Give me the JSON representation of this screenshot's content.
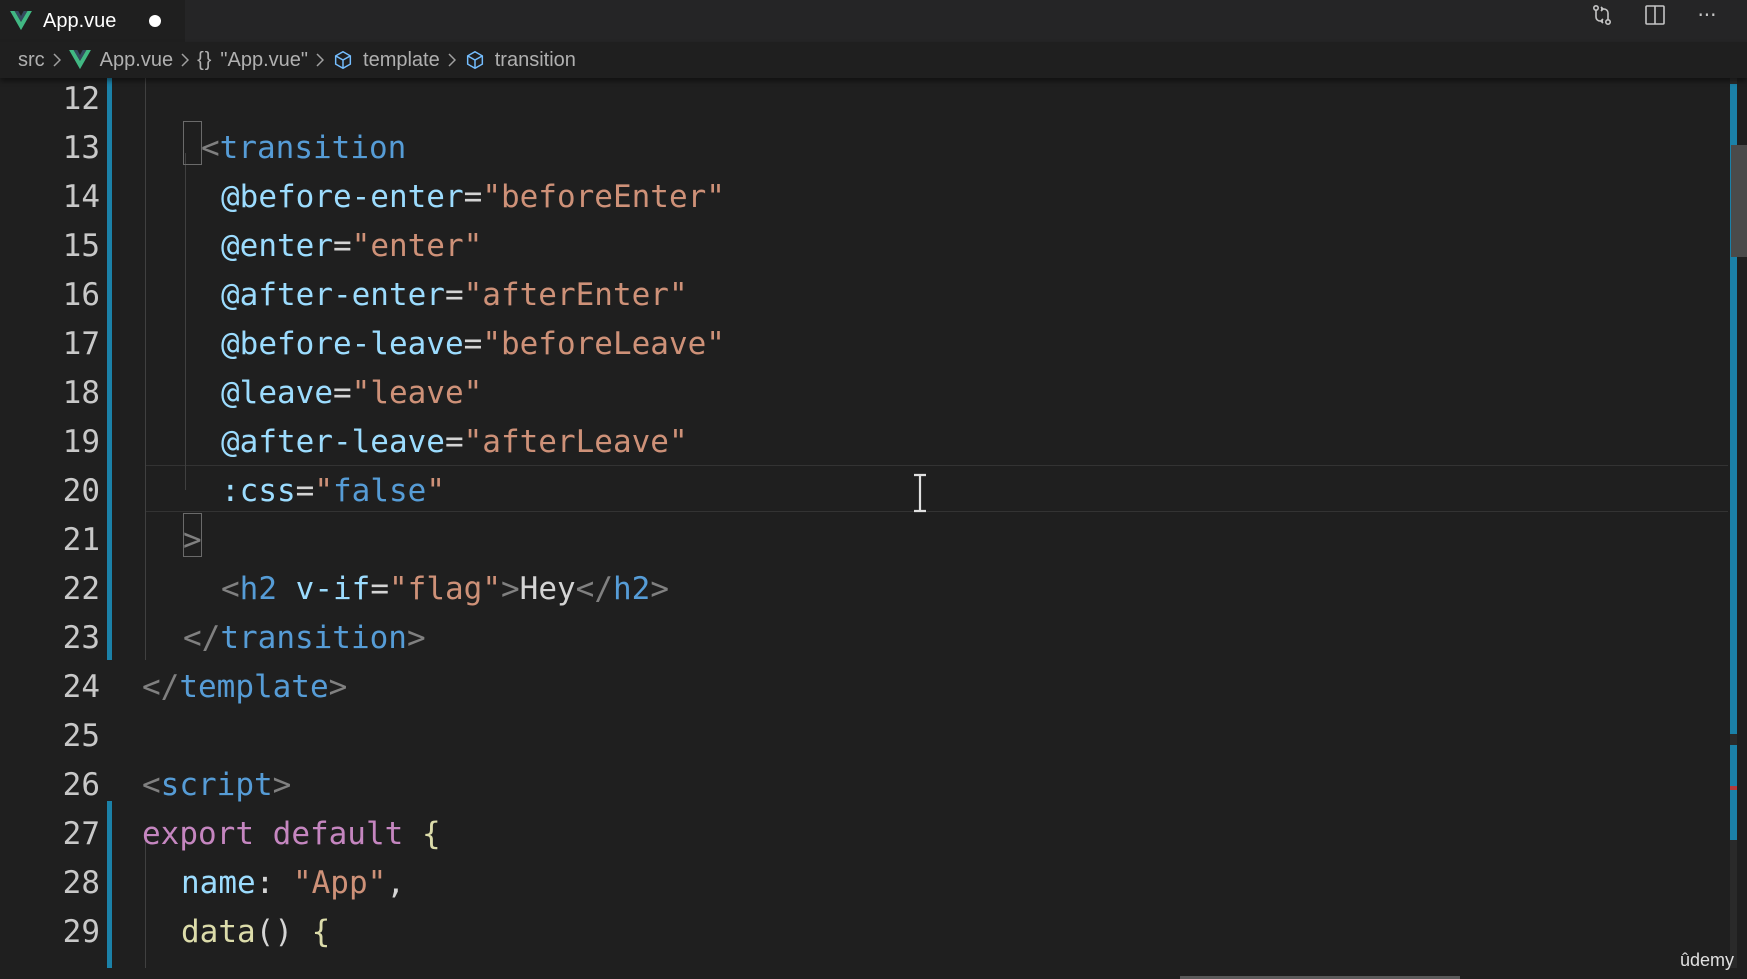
{
  "tab": {
    "title": "App.vue",
    "modified": true
  },
  "toolbar": {
    "icons": [
      "git-compare-icon",
      "split-editor-icon",
      "more-actions-icon"
    ],
    "more_label": "···"
  },
  "breadcrumb": {
    "items": [
      {
        "label": "src",
        "icon": ""
      },
      {
        "label": "App.vue",
        "icon": "vue-file-icon"
      },
      {
        "label": "\"App.vue\"",
        "icon": "braces-icon",
        "prefix": "{}"
      },
      {
        "label": "template",
        "icon": "symbol-cube-icon"
      },
      {
        "label": "transition",
        "icon": "symbol-cube-icon"
      }
    ]
  },
  "editor": {
    "lines": [
      {
        "num": "12",
        "tokens": []
      },
      {
        "num": "13",
        "tokens": [
          [
            "punct",
            "<"
          ],
          [
            "tag",
            "transition"
          ]
        ]
      },
      {
        "num": "14",
        "tokens": [
          [
            "attr",
            "@before-enter"
          ],
          [
            "text",
            "="
          ],
          [
            "str",
            "\"beforeEnter\""
          ]
        ]
      },
      {
        "num": "15",
        "tokens": [
          [
            "attr",
            "@enter"
          ],
          [
            "text",
            "="
          ],
          [
            "str",
            "\"enter\""
          ]
        ]
      },
      {
        "num": "16",
        "tokens": [
          [
            "attr",
            "@after-enter"
          ],
          [
            "text",
            "="
          ],
          [
            "str",
            "\"afterEnter\""
          ]
        ]
      },
      {
        "num": "17",
        "tokens": [
          [
            "attr",
            "@before-leave"
          ],
          [
            "text",
            "="
          ],
          [
            "str",
            "\"beforeLeave\""
          ]
        ]
      },
      {
        "num": "18",
        "tokens": [
          [
            "attr",
            "@leave"
          ],
          [
            "text",
            "="
          ],
          [
            "str",
            "\"leave\""
          ]
        ]
      },
      {
        "num": "19",
        "tokens": [
          [
            "attr",
            "@after-leave"
          ],
          [
            "text",
            "="
          ],
          [
            "str",
            "\"afterLeave\""
          ]
        ]
      },
      {
        "num": "20",
        "tokens": [
          [
            "attr",
            ":css"
          ],
          [
            "text",
            "="
          ],
          [
            "str",
            "\""
          ],
          [
            "bool",
            "false"
          ],
          [
            "str",
            "\""
          ]
        ]
      },
      {
        "num": "21",
        "tokens": [
          [
            "punct",
            ">"
          ]
        ]
      },
      {
        "num": "22",
        "tokens": [
          [
            "punct",
            "<"
          ],
          [
            "tag",
            "h2"
          ],
          [
            "text",
            " "
          ],
          [
            "attr",
            "v-if"
          ],
          [
            "text",
            "="
          ],
          [
            "str",
            "\"flag\""
          ],
          [
            "punct",
            ">"
          ],
          [
            "text",
            "Hey"
          ],
          [
            "punct",
            "</"
          ],
          [
            "tag",
            "h2"
          ],
          [
            "punct",
            ">"
          ]
        ]
      },
      {
        "num": "23",
        "tokens": [
          [
            "punct",
            "</"
          ],
          [
            "tag",
            "transition"
          ],
          [
            "punct",
            ">"
          ]
        ]
      },
      {
        "num": "24",
        "tokens": [
          [
            "punct",
            "</"
          ],
          [
            "tag",
            "template"
          ],
          [
            "punct",
            ">"
          ]
        ]
      },
      {
        "num": "25",
        "tokens": []
      },
      {
        "num": "26",
        "tokens": [
          [
            "punct",
            "<"
          ],
          [
            "tag",
            "script"
          ],
          [
            "punct",
            ">"
          ]
        ]
      },
      {
        "num": "27",
        "tokens": [
          [
            "kw",
            "export"
          ],
          [
            "text",
            " "
          ],
          [
            "kw",
            "default"
          ],
          [
            "text",
            " "
          ],
          [
            "fn",
            "{"
          ]
        ]
      },
      {
        "num": "28",
        "tokens": [
          [
            "attr",
            "name"
          ],
          [
            "text",
            ": "
          ],
          [
            "str",
            "\"App\""
          ],
          [
            "text",
            ","
          ]
        ]
      },
      {
        "num": "29",
        "tokens": [
          [
            "fn",
            "data"
          ],
          [
            "text",
            "() "
          ],
          [
            "fn",
            "{"
          ]
        ]
      }
    ]
  },
  "colors": {
    "background": "#1f1f1f",
    "tag": "#569cd6",
    "attribute": "#9cdcfe",
    "string": "#ce9178",
    "keyword": "#c586c0",
    "function": "#dcdcaa",
    "git_modified": "#1b81a8"
  },
  "watermark": "ûdemy"
}
